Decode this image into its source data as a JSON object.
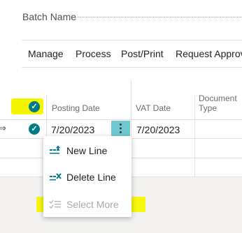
{
  "header": {
    "batch_label": "Batch Name"
  },
  "actions": {
    "items": [
      "Manage",
      "Process",
      "Post/Print",
      "Request Approval"
    ]
  },
  "columns": {
    "posting_date": "Posting Date",
    "vat_date": "VAT Date",
    "document_type_line1": "Document",
    "document_type_line2": "Type"
  },
  "row": {
    "arrow": "⇒",
    "posting_date": "7/20/2023",
    "vat_date": "7/20/2023",
    "kebab": "⋮"
  },
  "menu": {
    "items": [
      {
        "label": "New Line",
        "icon": "new-line-icon",
        "enabled": true
      },
      {
        "label": "Delete Line",
        "icon": "delete-line-icon",
        "enabled": true
      },
      {
        "label": "Select More",
        "icon": "select-more-icon",
        "enabled": false
      }
    ]
  },
  "colors": {
    "accent": "#007c87",
    "highlight": "#f5f500",
    "kebab_bg": "#6ec8cf"
  }
}
